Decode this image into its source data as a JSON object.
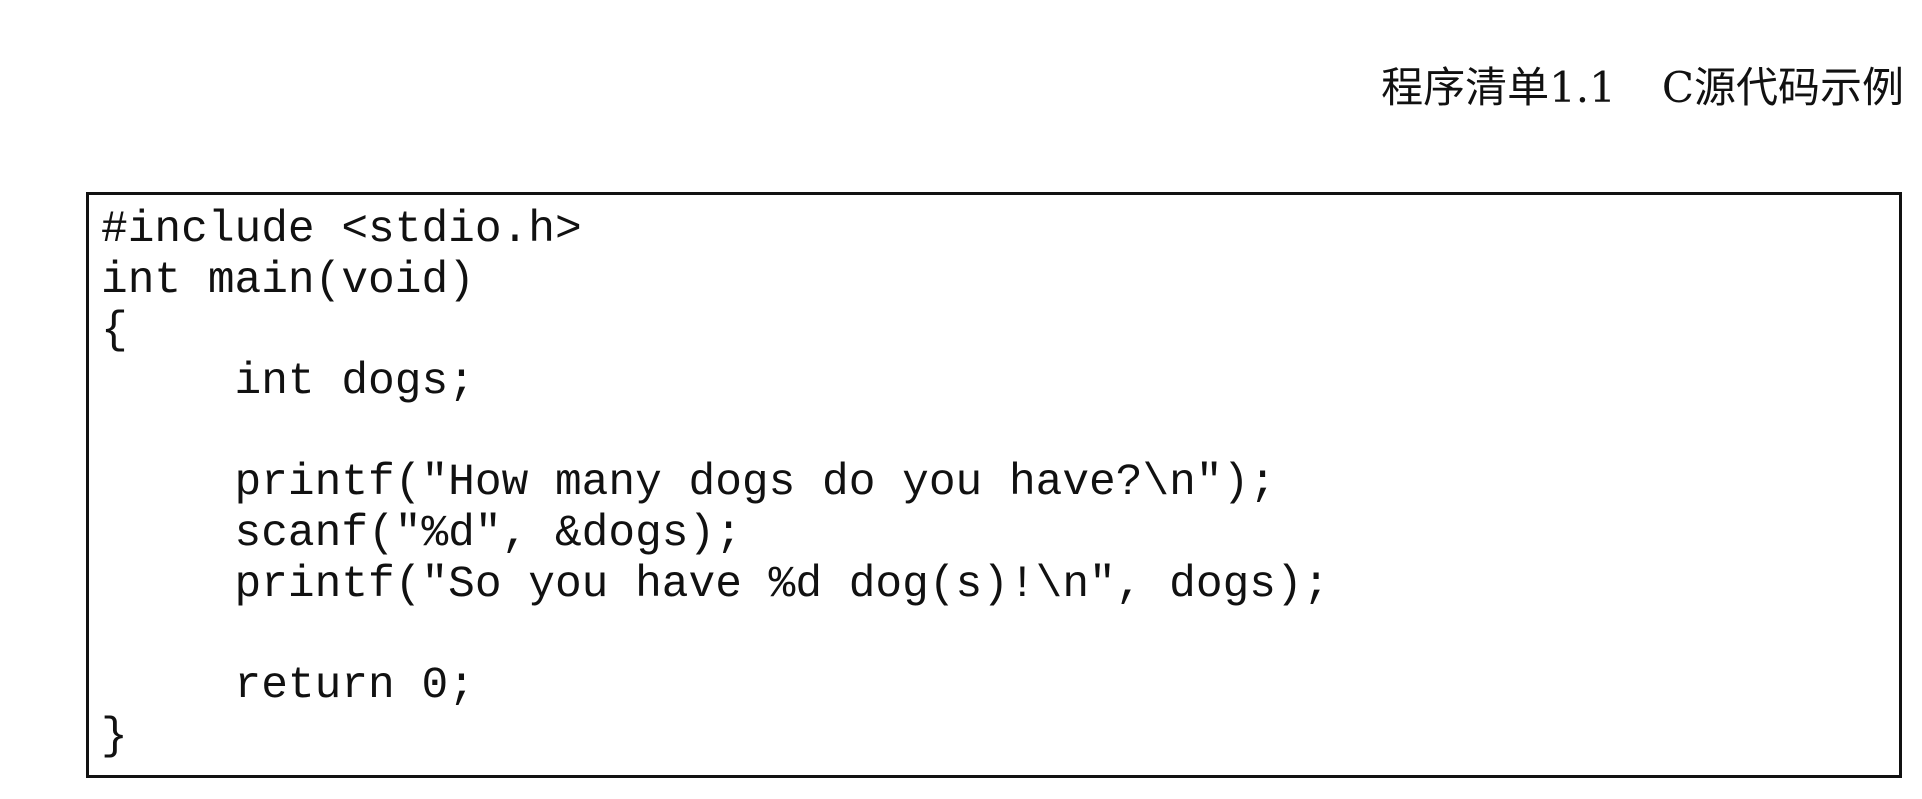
{
  "caption": {
    "label": "程序清单1.1",
    "title": "C源代码示例"
  },
  "code": {
    "lines": [
      "#include <stdio.h>",
      "int main(void)",
      "{",
      "     int dogs;",
      "",
      "     printf(\"How many dogs do you have?\\n\");",
      "     scanf(\"%d\", &dogs);",
      "     printf(\"So you have %d dog(s)!\\n\", dogs);",
      "",
      "     return 0;",
      "}"
    ]
  }
}
